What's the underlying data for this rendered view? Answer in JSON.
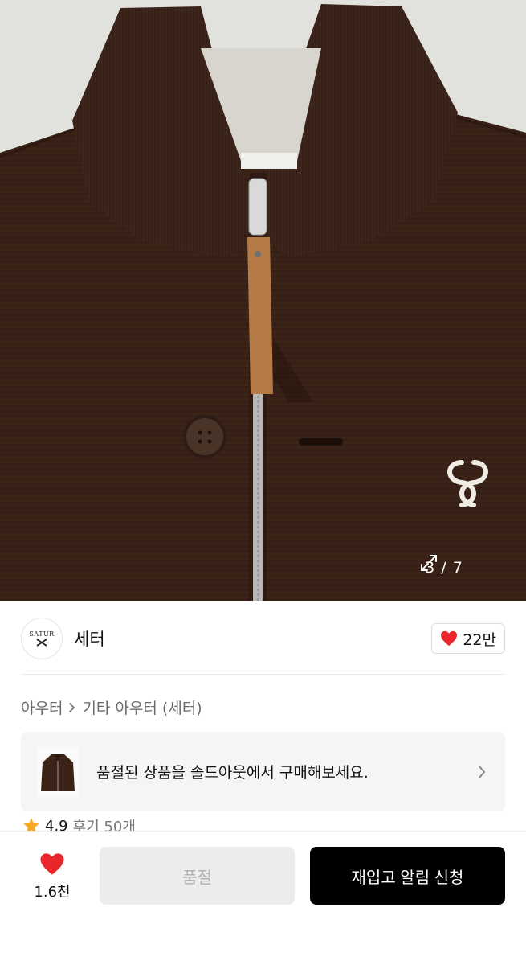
{
  "gallery": {
    "current": "3",
    "total": "7",
    "counter_text": "3 / 7",
    "expand_icon": "expand-icon"
  },
  "brand": {
    "logo_text": "SATUR",
    "name": "세터",
    "like_count": "22만"
  },
  "breadcrumb": {
    "items": [
      "아우터",
      "기타 아우터 (세터)"
    ]
  },
  "soldout_banner": {
    "text": "품절된 상품을 솔드아웃에서 구매해보세요."
  },
  "rating": {
    "score": "4.9",
    "reviews": "후기 50개"
  },
  "bottom_bar": {
    "wish_count": "1.6천",
    "soldout_label": "품절",
    "restock_label": "재입고 알림 신청"
  },
  "colors": {
    "heart": "#e8262c",
    "star": "#f5a623",
    "restock_button": "#000000",
    "soldout_button": "#ececec",
    "garment": "#3b2318"
  }
}
